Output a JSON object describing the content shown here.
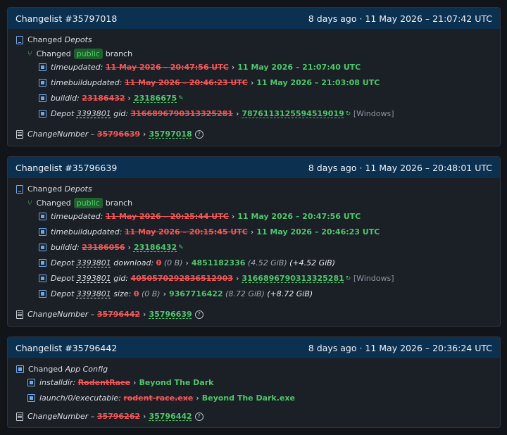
{
  "changelists": [
    {
      "title": "Changelist #35797018",
      "time": "8 days ago · 11 May 2026 – 21:07:42 UTC",
      "changed_prefix": "Changed",
      "changed_what": "Depots",
      "branch_prefix": "Changed",
      "branch_badge": "public",
      "branch_suffix": "branch",
      "rows": [
        {
          "label": "timeupdated:",
          "old": "11 May 2026 – 20:47:56 UTC",
          "new": "11 May 2026 – 21:07:40 UTC"
        },
        {
          "label": "timebuildupdated:",
          "old": "11 May 2026 – 20:46:23 UTC",
          "new": "11 May 2026 – 21:03:08 UTC"
        },
        {
          "label": "buildid:",
          "old": "23186432",
          "new": "23186675"
        },
        {
          "label_a": "Depot",
          "depot": "3393801",
          "label_b": "gid:",
          "old": "3166896790313325281",
          "new": "7876113125594519019",
          "extra": "[Windows]"
        }
      ],
      "cn_label": "ChangeNumber –",
      "cn_old": "35796639",
      "cn_new": "35797018"
    },
    {
      "title": "Changelist #35796639",
      "time": "8 days ago · 11 May 2026 – 20:48:01 UTC",
      "changed_prefix": "Changed",
      "changed_what": "Depots",
      "branch_prefix": "Changed",
      "branch_badge": "public",
      "branch_suffix": "branch",
      "rows": [
        {
          "label": "timeupdated:",
          "old": "11 May 2026 – 20:25:44 UTC",
          "new": "11 May 2026 – 20:47:56 UTC"
        },
        {
          "label": "timebuildupdated:",
          "old": "11 May 2026 – 20:15:45 UTC",
          "new": "11 May 2026 – 20:46:23 UTC"
        },
        {
          "label": "buildid:",
          "old": "23186056",
          "new": "23186432"
        },
        {
          "label_a": "Depot",
          "depot": "3393801",
          "label_b": "download:",
          "old": "0",
          "old_size": "(0 B)",
          "new": "4851182336",
          "new_size": "(4.52 GiB)",
          "delta": "(+4.52 GiB)"
        },
        {
          "label_a": "Depot",
          "depot": "3393801",
          "label_b": "gid:",
          "old": "4050570292836512903",
          "new": "3166896790313325281",
          "extra": "[Windows]"
        },
        {
          "label_a": "Depot",
          "depot": "3393801",
          "label_b": "size:",
          "old": "0",
          "old_size": "(0 B)",
          "new": "9367716422",
          "new_size": "(8.72 GiB)",
          "delta": "(+8.72 GiB)"
        }
      ],
      "cn_label": "ChangeNumber –",
      "cn_old": "35796442",
      "cn_new": "35796639"
    },
    {
      "title": "Changelist #35796442",
      "time": "8 days ago · 11 May 2026 – 20:36:24 UTC",
      "changed_prefix": "Changed",
      "changed_what": "App Config",
      "rows": [
        {
          "label": "installdir:",
          "old": "RodentRace",
          "new": "Beyond The Dark"
        },
        {
          "label": "launch/0/executable:",
          "old": "rodent-race.exe",
          "new": "Beyond The Dark.exe"
        }
      ],
      "cn_label": "ChangeNumber –",
      "cn_old": "35796262",
      "cn_new": "35796442"
    }
  ],
  "arrow": "›",
  "help_glyph": "?",
  "colors": {
    "header_bg": "#0c3050",
    "old": "#f25757",
    "new": "#4cc76a",
    "badge_bg": "#1f5f2c"
  }
}
